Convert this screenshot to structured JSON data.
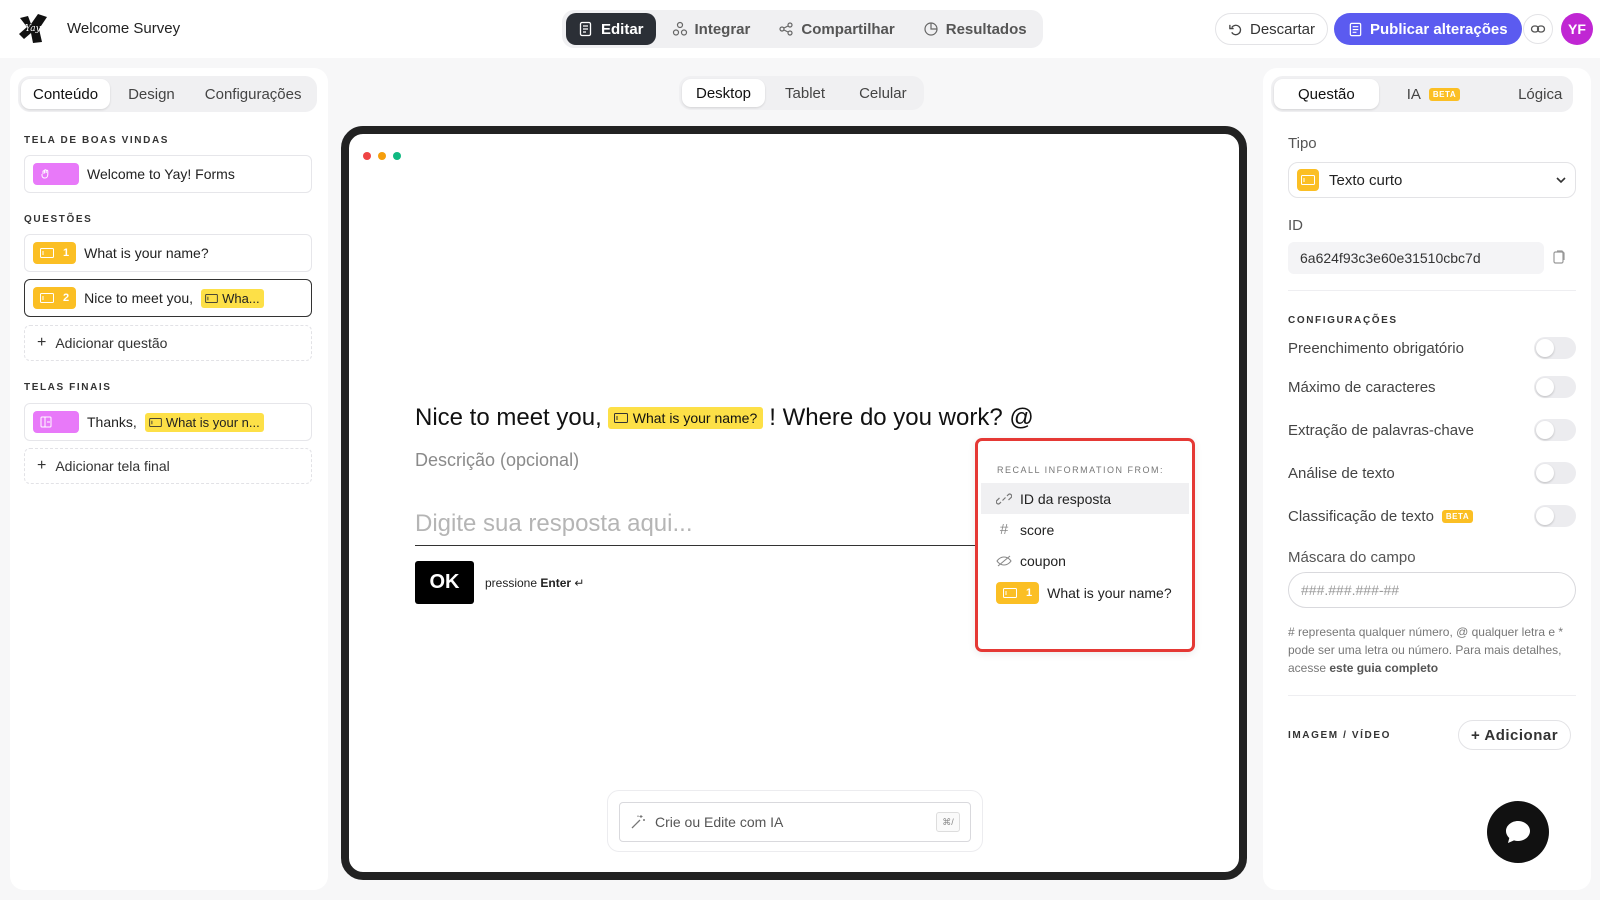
{
  "header": {
    "form_title": "Welcome Survey",
    "tabs": [
      {
        "label": "Editar",
        "icon": "edit-icon",
        "active": true
      },
      {
        "label": "Integrar",
        "icon": "integrate-icon"
      },
      {
        "label": "Compartilhar",
        "icon": "share-icon"
      },
      {
        "label": "Resultados",
        "icon": "results-icon"
      }
    ],
    "discard_label": "Descartar",
    "publish_label": "Publicar alterações",
    "avatar_initials": "YF",
    "avatar_color": "#c026d3",
    "publish_color": "#5b5bf0"
  },
  "left": {
    "tabs": [
      "Conteúdo",
      "Design",
      "Configurações"
    ],
    "active_tab": "Conteúdo",
    "welcome_label": "TELA DE BOAS VINDAS",
    "welcome_item": "Welcome to Yay! Forms",
    "questions_label": "QUESTÕES",
    "questions": [
      {
        "number": "1",
        "text": "What is your name?"
      },
      {
        "number": "2",
        "text": "Nice to meet you,",
        "chip": "Wha..."
      }
    ],
    "add_question": "Adicionar questão",
    "endings_label": "TELAS FINAIS",
    "ending_item": {
      "text": "Thanks,",
      "chip": "What is your n..."
    },
    "add_ending": "Adicionar tela final"
  },
  "center": {
    "devices": [
      "Desktop",
      "Tablet",
      "Celular"
    ],
    "active_device": "Desktop",
    "question": {
      "prefix": "Nice to meet you,",
      "chip": "What is your name?",
      "suffix": "! Where do you work? @",
      "description": "Descrição (opcional)",
      "placeholder": "Digite sua resposta aqui...",
      "ok": "OK",
      "hint_prefix": "pressione",
      "hint_key": "Enter",
      "hint_symbol": "↵"
    },
    "recall": {
      "heading": "RECALL INFORMATION FROM:",
      "items": [
        {
          "label": "ID da resposta",
          "icon": "link-icon"
        },
        {
          "label": "score",
          "icon": "hash-icon"
        },
        {
          "label": "coupon",
          "icon": "hidden-icon"
        },
        {
          "label": "What is your name?",
          "number": "1"
        }
      ]
    },
    "ai_placeholder": "Crie ou Edite com IA",
    "ai_shortcut": "⌘/"
  },
  "right": {
    "tabs": [
      "Questão",
      "IA",
      "Lógica"
    ],
    "active_tab": "Questão",
    "beta": "BETA",
    "type_label": "Tipo",
    "type_value": "Texto curto",
    "id_label": "ID",
    "id_value": "6a624f93c3e60e31510cbc7d",
    "settings_label": "CONFIGURAÇÕES",
    "toggles": [
      "Preenchimento obrigatório",
      "Máximo de caracteres",
      "Extração de palavras-chave",
      "Análise de texto",
      "Classificação de texto"
    ],
    "mask_label": "Máscara do campo",
    "mask_placeholder": "###.###.###-##",
    "help_text": "# representa qualquer número, @ qualquer letra e * pode ser uma letra ou número. Para mais detalhes, acesse",
    "help_link": "este guia completo",
    "media_label": "IMAGEM / VÍDEO",
    "add_label": "+ Adicionar"
  }
}
